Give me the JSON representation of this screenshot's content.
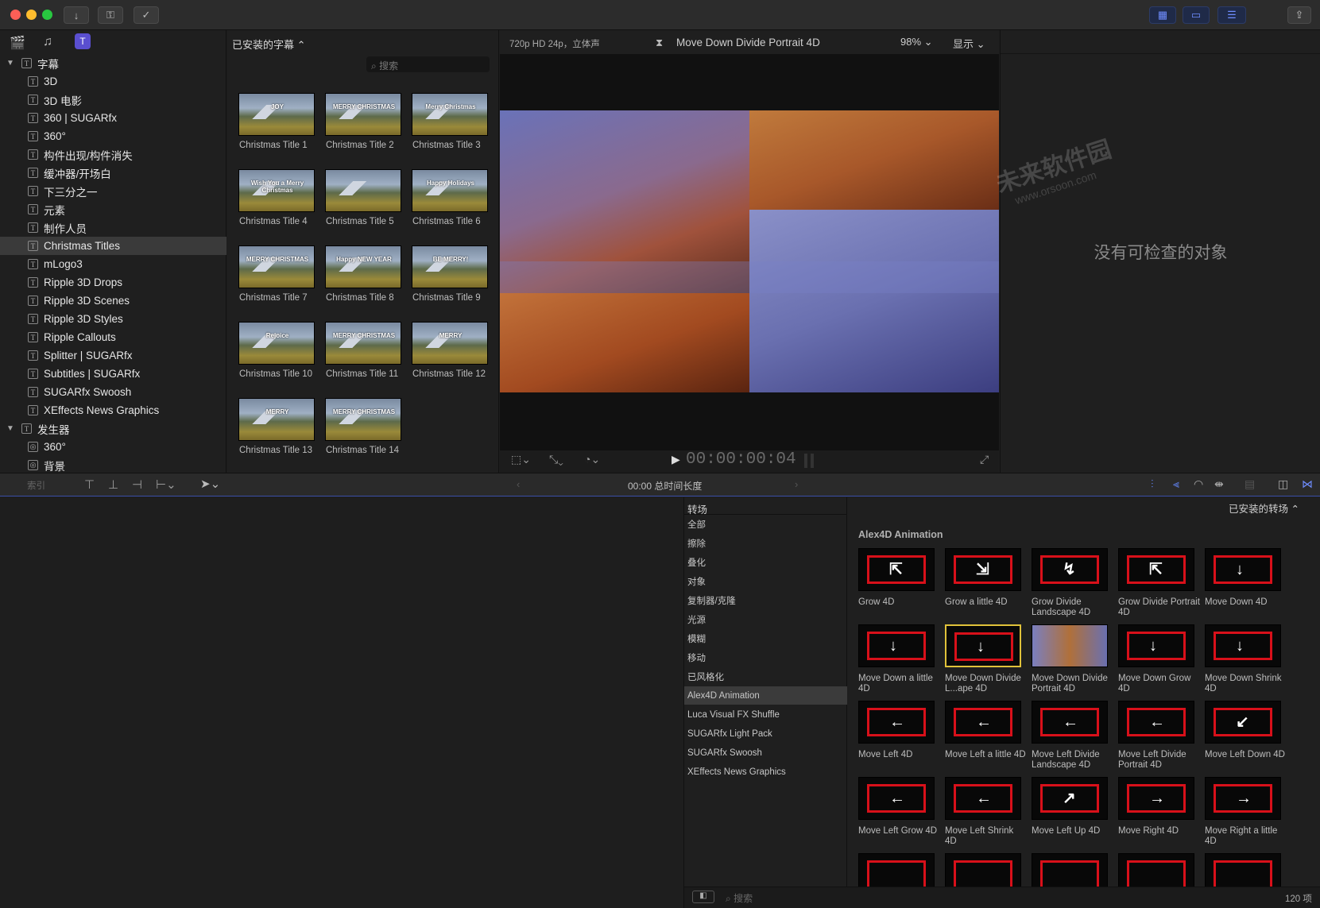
{
  "toolbar": {
    "left_icons": [
      "import-icon",
      "keywords-icon",
      "analysis-check-icon"
    ],
    "right_icons": [
      "browser-toggle-icon",
      "timeline-toggle-icon",
      "inspector-toggle-icon",
      "share-icon"
    ]
  },
  "library": {
    "tabs": [
      "libraries-tab-icon",
      "photos-audio-tab-icon",
      "titles-generators-tab-icon"
    ],
    "sections": [
      {
        "label": "字幕",
        "items": [
          "3D",
          "3D 电影",
          "360 | SUGARfx",
          "360°",
          "构件出现/构件消失",
          "缓冲器/开场白",
          "下三分之一",
          "元素",
          "制作人员",
          "Christmas Titles",
          "mLogo3",
          "Ripple 3D Drops",
          "Ripple 3D Scenes",
          "Ripple 3D Styles",
          "Ripple Callouts",
          "Splitter | SUGARfx",
          "Subtitles | SUGARfx",
          "SUGARfx Swoosh",
          "XEffects News Graphics"
        ]
      },
      {
        "label": "发生器",
        "items": [
          "360°",
          "背景"
        ]
      }
    ],
    "selected": "Christmas Titles"
  },
  "titles_browser": {
    "header": "已安装的字幕",
    "search_placeholder": "搜索",
    "items": [
      "Christmas Title 1",
      "Christmas Title 2",
      "Christmas Title 3",
      "Christmas Title 4",
      "Christmas Title 5",
      "Christmas Title 6",
      "Christmas Title 7",
      "Christmas Title 8",
      "Christmas Title 9",
      "Christmas Title 10",
      "Christmas Title 11",
      "Christmas Title 12",
      "Christmas Title 13",
      "Christmas Title 14"
    ],
    "thumb_texts": [
      "JOY",
      "MERRY CHRISTMAS",
      "Merry Christmas",
      "Wish You a Merry Christmas",
      "",
      "Happy Holidays",
      "MERRY CHRISTMAS",
      "Happy NEW YEAR",
      "BE MERRY!",
      "Rejoice",
      "MERRY CHRISTMAS",
      "MERRY",
      "MERRY",
      "MERRY CHRISTMAS"
    ]
  },
  "viewer": {
    "format": "720p HD 24p，立体声",
    "title": "Move Down Divide Portrait 4D",
    "zoom": "98%",
    "display": "显示",
    "timecode": "00:00:00:04"
  },
  "inspector": {
    "empty_text": "没有可检查的对象"
  },
  "timeline_bar": {
    "index": "索引",
    "duration": "00:00 总时间长度"
  },
  "transitions": {
    "header": "转场",
    "installed": "已安装的转场",
    "categories": [
      "全部",
      "擦除",
      "叠化",
      "对象",
      "复制器/克隆",
      "光源",
      "模糊",
      "移动",
      "已风格化",
      "Alex4D Animation",
      "Luca Visual FX Shuffle",
      "SUGARfx Light Pack",
      "SUGARfx Swoosh",
      "XEffects News Graphics"
    ],
    "selected_category": "Alex4D Animation",
    "group_title": "Alex4D Animation",
    "items": [
      "Grow 4D",
      "Grow a little 4D",
      "Grow Divide Landscape 4D",
      "Grow Divide Portrait 4D",
      "Move Down 4D",
      "Move Down a little 4D",
      "Move Down Divide L...ape 4D",
      "Move Down Divide Portrait 4D",
      "Move Down Grow 4D",
      "Move Down Shrink 4D",
      "Move Left 4D",
      "Move Left a little 4D",
      "Move Left Divide Landscape 4D",
      "Move Left Divide Portrait 4D",
      "Move Left Down 4D",
      "Move Left Grow 4D",
      "Move Left Shrink 4D",
      "Move Left Up 4D",
      "Move Right 4D",
      "Move Right a little 4D"
    ],
    "selected_item": "Move Down Divide L...ape 4D",
    "count": "120 项",
    "search_placeholder": "搜索"
  },
  "watermark": {
    "brand": "未来软件园",
    "url": "www.orsoon.com"
  },
  "colors": {
    "accent": "#d8101a",
    "selection": "#e0c23a",
    "blue": "#6f8dff"
  }
}
